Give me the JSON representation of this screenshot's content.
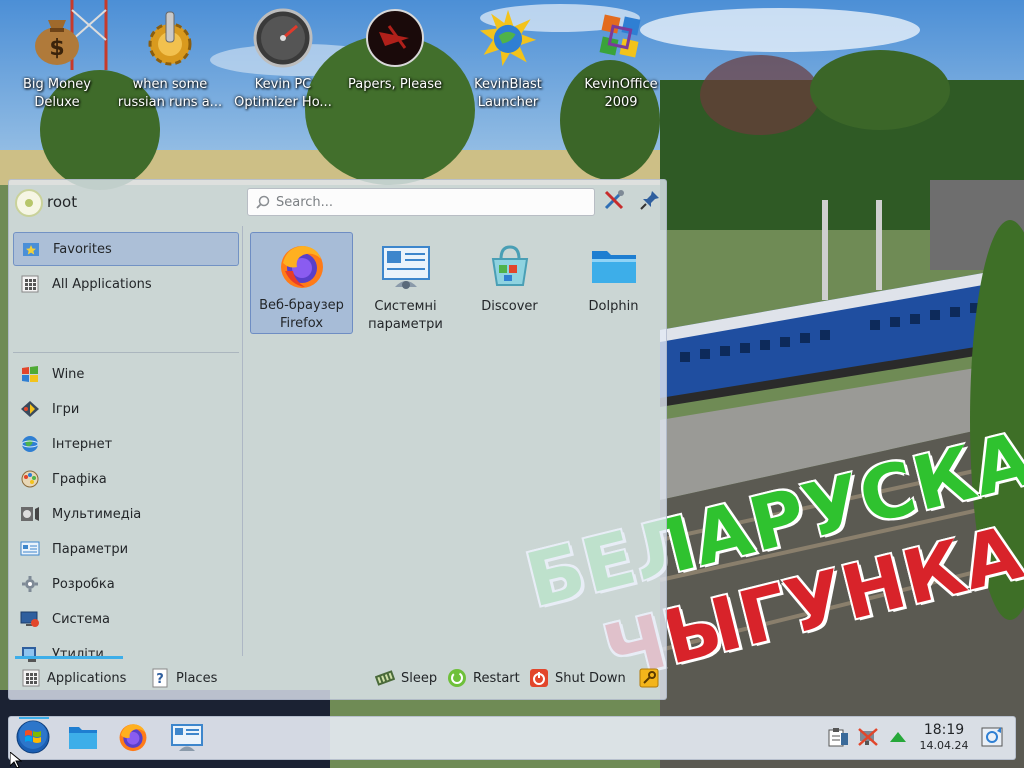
{
  "desktop": {
    "icons": [
      {
        "label": "Big Money Deluxe",
        "icon": "money-bag-icon"
      },
      {
        "label": "when some russian runs a...",
        "icon": "gear-icon"
      },
      {
        "label": "Kevin PC Optimizer Ho...",
        "icon": "speedometer-icon"
      },
      {
        "label": "Papers, Please",
        "icon": "papers-please-icon"
      },
      {
        "label": "KevinBlast Launcher",
        "icon": "globe-burst-icon"
      },
      {
        "label": "KevinOffice 2009",
        "icon": "office-logo-icon"
      }
    ],
    "wallpaper_text": [
      "БЕЛАРУСКАЯ",
      "ЧЫГУНКА"
    ]
  },
  "start_menu": {
    "user": "root",
    "search": {
      "placeholder": "Search..."
    },
    "categories": [
      {
        "label": "Favorites",
        "icon": "star-folder-icon",
        "selected": true
      },
      {
        "label": "All Applications",
        "icon": "grid-icon"
      },
      {
        "label": "Wine",
        "icon": "wine-icon"
      },
      {
        "label": "Ігри",
        "icon": "games-icon"
      },
      {
        "label": "Інтернет",
        "icon": "globe-icon"
      },
      {
        "label": "Графіка",
        "icon": "graphics-icon"
      },
      {
        "label": "Мультимедіа",
        "icon": "multimedia-icon"
      },
      {
        "label": "Параметри",
        "icon": "settings-icon"
      },
      {
        "label": "Розробка",
        "icon": "development-icon"
      },
      {
        "label": "Система",
        "icon": "system-icon"
      },
      {
        "label": "Утиліти",
        "icon": "utilities-icon"
      }
    ],
    "favorites": [
      {
        "label": "Веб-браузер Firefox",
        "icon": "firefox-icon",
        "selected": true
      },
      {
        "label": "Системні параметри",
        "icon": "system-settings-icon"
      },
      {
        "label": "Discover",
        "icon": "discover-icon"
      },
      {
        "label": "Dolphin",
        "icon": "folder-icon"
      }
    ],
    "footer": {
      "applications": "Applications",
      "places": "Places",
      "sleep": "Sleep",
      "restart": "Restart",
      "shutdown": "Shut Down"
    }
  },
  "taskbar": {
    "clock_time": "18:19",
    "clock_date": "14.04.24"
  },
  "colors": {
    "accent": "#3daee9",
    "selection": "#93add8"
  }
}
